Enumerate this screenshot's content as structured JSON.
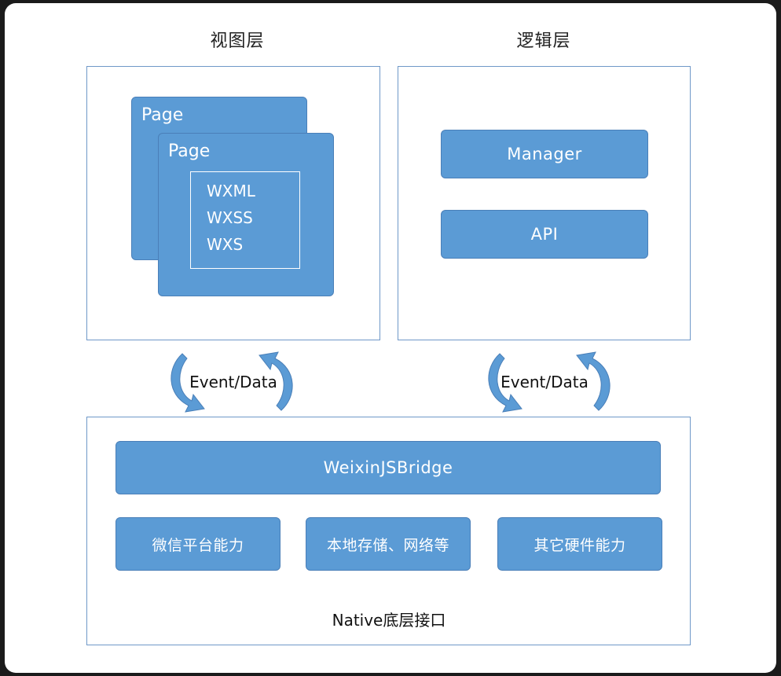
{
  "view_layer": {
    "title": "视图层",
    "page_back_label": "Page",
    "page_front_label": "Page",
    "files": [
      "WXML",
      "WXSS",
      "WXS"
    ]
  },
  "logic_layer": {
    "title": "逻辑层",
    "manager_label": "Manager",
    "api_label": "API"
  },
  "connectors": {
    "left_label": "Event/Data",
    "right_label": "Event/Data"
  },
  "native_layer": {
    "bridge_label": "WeixinJSBridge",
    "capabilities": [
      "微信平台能力",
      "本地存储、网络等",
      "其它硬件能力"
    ],
    "footer_label": "Native底层接口"
  },
  "colors": {
    "box_fill": "#5b9bd5",
    "box_border": "#4a7fb8",
    "panel_border": "#6f98c8",
    "arrow": "#5b9bd5"
  }
}
